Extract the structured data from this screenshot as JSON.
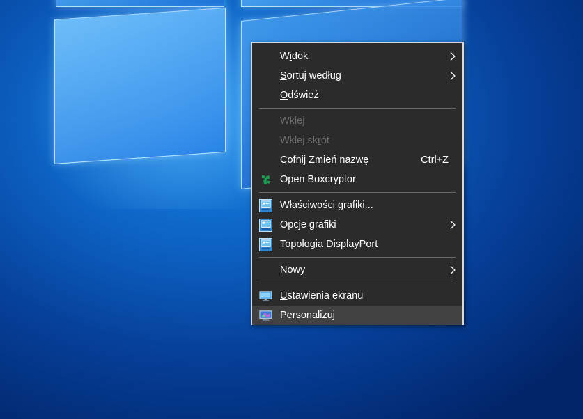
{
  "desktop": {
    "wallpaper": "Windows 10 hero (blue window panes)"
  },
  "context_menu": {
    "groups": [
      [
        {
          "label": "Widok",
          "underline_index": 1,
          "submenu": true
        },
        {
          "label": "Sortuj według",
          "underline_index": 0,
          "submenu": true
        },
        {
          "label": "Odśwież",
          "underline_index": 0
        }
      ],
      [
        {
          "label": "Wklej",
          "underline_index": 4,
          "disabled": true
        },
        {
          "label": "Wklej skrót",
          "underline_index": 8,
          "disabled": true
        },
        {
          "label": "Cofnij Zmień nazwę",
          "underline_index": 0,
          "shortcut": "Ctrl+Z"
        },
        {
          "label": "Open Boxcryptor",
          "icon": "boxcryptor-icon"
        }
      ],
      [
        {
          "label": "Właściwości grafiki...",
          "icon": "intel-graphics-icon"
        },
        {
          "label": "Opcje grafiki",
          "icon": "intel-graphics-icon",
          "submenu": true
        },
        {
          "label": "Topologia DisplayPort",
          "icon": "intel-graphics-icon"
        }
      ],
      [
        {
          "label": "Nowy",
          "underline_index": 0,
          "submenu": true
        }
      ],
      [
        {
          "label": "Ustawienia ekranu",
          "underline_index": 0,
          "icon": "display-settings-icon"
        },
        {
          "label": "Personalizuj",
          "underline_index": 2,
          "icon": "personalize-icon",
          "highlighted": true
        }
      ]
    ]
  },
  "colors": {
    "menu_bg": "#2b2b2b",
    "menu_border": "#d9d9d9",
    "highlight": "#414141",
    "disabled_text": "#6d6d6d",
    "boxcryptor_green": "#1e9a52"
  }
}
